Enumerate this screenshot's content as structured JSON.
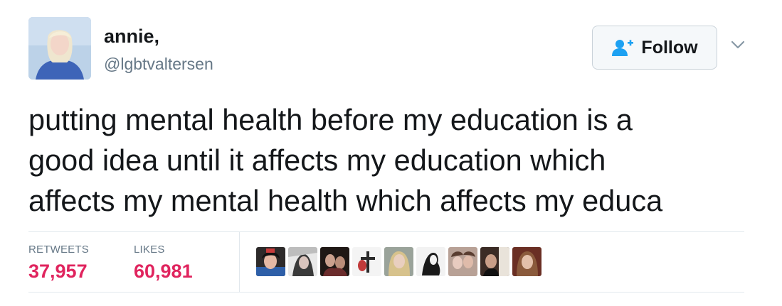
{
  "tweet": {
    "author": {
      "name": "annie,",
      "handle": "@lgbtvaltersen",
      "avatar_icon": "profile-photo"
    },
    "follow_label": "Follow",
    "follow_icon": "add-user-icon",
    "menu_icon": "chevron-down-icon",
    "text_lines": [
      "putting mental health before my education is a",
      "good idea until it affects my education which",
      "affects my mental health which affects my educa"
    ],
    "stats": {
      "retweets_label": "RETWEETS",
      "retweets_value": "37,957",
      "likes_label": "LIKES",
      "likes_value": "60,981"
    },
    "likers_count_shown": 9
  },
  "colors": {
    "accent_blue": "#1da1f2",
    "like_red": "#e0245e",
    "muted_gray": "#657786",
    "border": "#e1e8ed"
  }
}
